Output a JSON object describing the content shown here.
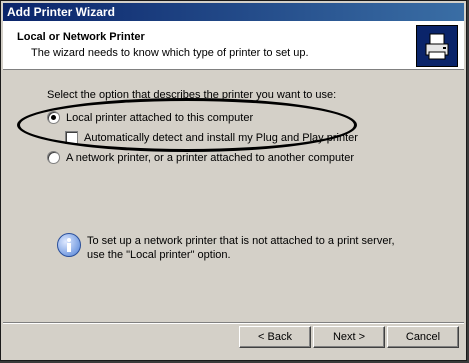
{
  "window": {
    "title": "Add Printer Wizard"
  },
  "header": {
    "title": "Local or Network Printer",
    "subtitle": "The wizard needs to know which type of printer to set up.",
    "icon": "printer-icon"
  },
  "body": {
    "prompt": "Select the option that describes the printer you want to use:",
    "options": [
      {
        "label": "Local printer attached to this computer",
        "selected": true
      },
      {
        "label": "Automatically detect and install my Plug and Play printer",
        "checked": false
      },
      {
        "label": "A network printer, or a printer attached to another computer",
        "selected": false
      }
    ],
    "info": {
      "icon": "info-icon",
      "line1": "To set up a network printer that is not attached to a print server,",
      "line2": "use the \"Local printer\" option."
    }
  },
  "buttons": {
    "back": "< Back",
    "next": "Next >",
    "cancel": "Cancel"
  },
  "colors": {
    "title_bar": "#0a246a",
    "face": "#d4d0c8",
    "annotation": "#000000"
  }
}
